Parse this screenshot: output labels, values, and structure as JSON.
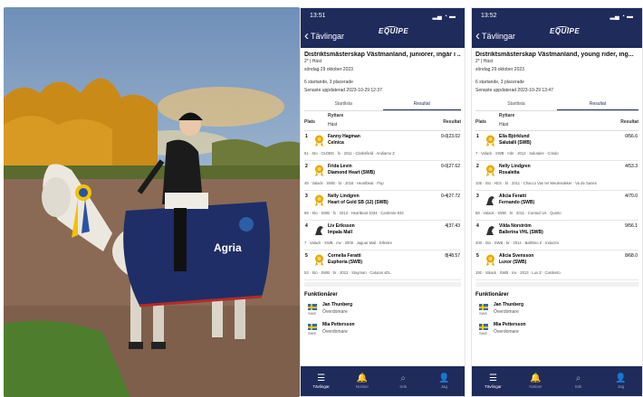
{
  "photo": {
    "cloth_text": "Agria"
  },
  "phones": [
    {
      "time": "13:51",
      "back_label": "Tävlingar",
      "logo": "EQUIPE",
      "title": "Distriktsmästerskap Västmanland, juniorer, ingår i ...",
      "class_type": "2* | Häst",
      "date": "söndag 29 oktober 2023",
      "counts": "6 startande, 3 placerade",
      "updated": "Senaste uppdaterad 2023-10-29 12:37",
      "seg_starts": "Startlista",
      "seg_results": "Resultat",
      "col_place": "Plats",
      "col_rider": "Ryttare",
      "col_horse": "Häst",
      "col_result": "Resultat",
      "rows": [
        {
          "place": "1",
          "rider": "Fanny Hagman",
          "horse": "Celnica",
          "result": "0-0|23.02",
          "info": "51 · Sto · OLDBG · fx · 2011 · Clarksfield · Andiamo Z",
          "badge": "rosette"
        },
        {
          "place": "2",
          "rider": "Frida Levin",
          "horse": "Diamond Heart (SWB)",
          "result": "0-0|27.62",
          "info": "48 · Valack · SWB · br · 2016 · Heartbeat · Pop",
          "badge": "rosette"
        },
        {
          "place": "3",
          "rider": "Nelly Lindgren",
          "horse": "Heart of Gold SB (12) (SWB)",
          "result": "0-4|27.72",
          "info": "69 · Sto · SWB · fx · 2013 · Heartbeat 1034 · Cardento 933",
          "badge": "rosette"
        },
        {
          "place": "4",
          "rider": "Liv Eriksson",
          "horse": "Impala Mall",
          "result": "4|37.43",
          "info": "7 · Valack · SWB · mv · 2009 · Jaguar Mail · Ellestre",
          "badge": "horse"
        },
        {
          "place": "5",
          "rider": "Cornelia Feratti",
          "horse": "Euphoria (SWB)",
          "result": "8|48.57",
          "info": "53 · Sto · SWB · br · 2012 · Stayman · Caluran vDL",
          "badge": "rosette"
        }
      ],
      "functionaries_title": "Funktionärer",
      "functionaries": [
        {
          "name": "Jan Thunberg",
          "role": "Överdomare",
          "cc": "SWE"
        },
        {
          "name": "Mia Pettersson",
          "role": "Överdomare",
          "cc": "SWE"
        }
      ],
      "tabs": [
        {
          "label": "Tävlingar",
          "icon": "menu-icon"
        },
        {
          "label": "Notiser",
          "icon": "bell-icon"
        },
        {
          "label": "Sök",
          "icon": "search-icon"
        },
        {
          "label": "Jag",
          "icon": "person-icon"
        }
      ]
    },
    {
      "time": "13:52",
      "back_label": "Tävlingar",
      "logo": "EQUIPE",
      "title": "Distriktsmästerskap Västmanland, young rider, ing...",
      "class_type": "2* | Häst",
      "date": "söndag 29 oktober 2023",
      "counts": "6 startande, 3 placerade",
      "updated": "Senaste uppdaterad 2023-10-29 13:47",
      "seg_starts": "Startlista",
      "seg_results": "Resultat",
      "col_place": "Plats",
      "col_rider": "Ryttare",
      "col_horse": "Häst",
      "col_result": "Resultat",
      "rows": [
        {
          "place": "1",
          "rider": "Ella Björklund",
          "horse": "Salutalli (SWB)",
          "result": "0/56.6",
          "info": "7 · Valack · SWB · mbr · 2012 · Salutaire · Crisdo",
          "badge": "rosette"
        },
        {
          "place": "2",
          "rider": "Nelly Lindgren",
          "horse": "Rosaletta",
          "result": "4/53.3",
          "info": "105 · Sto · AES · br · 2011 · Chacco Van ter Meulenakker · Va de Sanes",
          "badge": "rosette"
        },
        {
          "place": "3",
          "rider": "Alicia Feratti",
          "horse": "Fernando (SWB)",
          "result": "4/70.0",
          "info": "58 · Valack · SWB · br · 2011 · Contact Us · Quinto",
          "badge": "horse"
        },
        {
          "place": "4",
          "rider": "Vilda Norström",
          "horse": "Ballerina VHL (SWB)",
          "result": "9/56.1",
          "info": "200 · Sto · SWB · br · 2014 · Balthino Z · Indoctro",
          "badge": "horse"
        },
        {
          "place": "5",
          "rider": "Alicia Svensson",
          "horse": "Luxor (SWB)",
          "result": "8/68.0",
          "info": "192 · Valack · SWB · mv · 2013 · Lux Z · Cardento",
          "badge": "rosette"
        }
      ],
      "functionaries_title": "Funktionärer",
      "functionaries": [
        {
          "name": "Jan Thunberg",
          "role": "Överdomare",
          "cc": "SWE"
        },
        {
          "name": "Mia Pettersson",
          "role": "Överdomare",
          "cc": "SWE"
        }
      ],
      "tabs": [
        {
          "label": "Tävlingar",
          "icon": "menu-icon"
        },
        {
          "label": "Notiser",
          "icon": "bell-icon"
        },
        {
          "label": "Sök",
          "icon": "search-icon"
        },
        {
          "label": "Jag",
          "icon": "person-icon"
        }
      ]
    }
  ]
}
